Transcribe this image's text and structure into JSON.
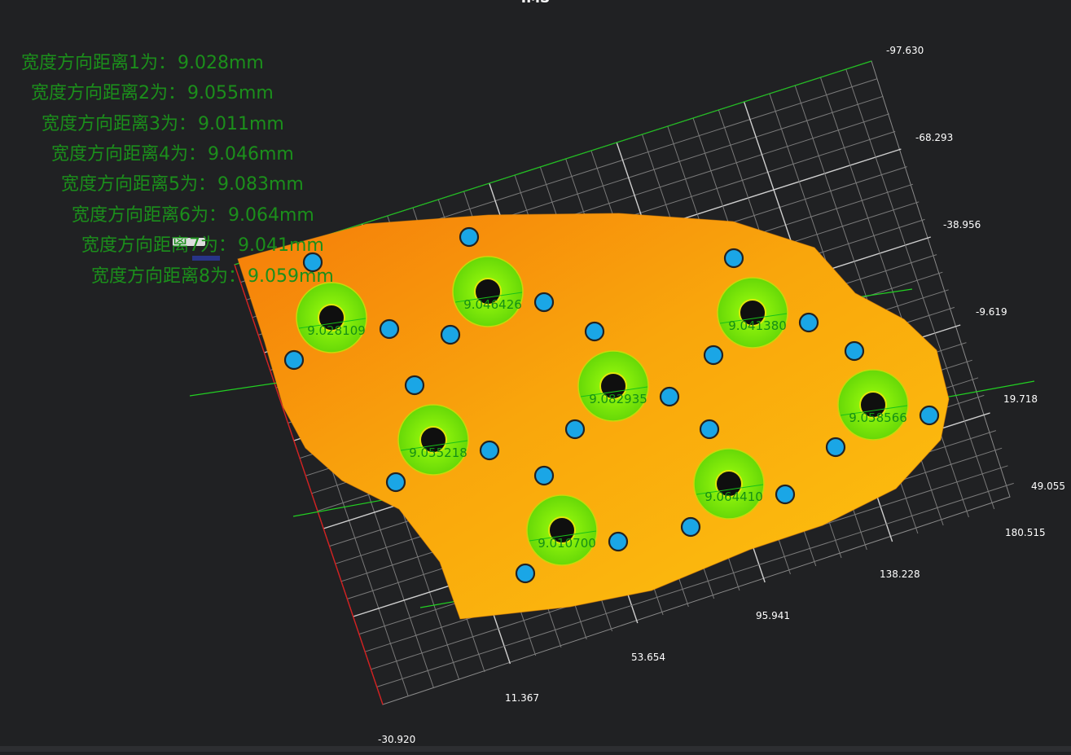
{
  "viewer": {
    "title": "IMS",
    "axis_ticks_right": [
      "-97.630",
      "-68.293",
      "-38.956",
      "-9.619",
      "19.718",
      "49.055"
    ],
    "axis_ticks_bottom": [
      "-30.920",
      "11.367",
      "53.654",
      "95.941",
      "138.228",
      "180.515"
    ]
  },
  "measurements": [
    {
      "label": "宽度方向距离1为：",
      "value": "9.028mm"
    },
    {
      "label": "宽度方向距离2为：",
      "value": "9.055mm"
    },
    {
      "label": "宽度方向距离3为：",
      "value": "9.011mm"
    },
    {
      "label": "宽度方向距离4为：",
      "value": "9.046mm"
    },
    {
      "label": "宽度方向距离5为：",
      "value": "9.083mm"
    },
    {
      "label": "宽度方向距离6为：",
      "value": "9.064mm"
    },
    {
      "label": "宽度方向距离7为：",
      "value": "9.041mm"
    },
    {
      "label": "宽度方向距离8为：",
      "value": "9.059mm"
    }
  ],
  "ring_labels": [
    "9.028109",
    "9.046426",
    "9.041380",
    "9.082935",
    "9.058566",
    "9.055218",
    "9.064410",
    "9.010700"
  ],
  "colors": {
    "background": "#202123",
    "grid": "#8a8a8a",
    "axis_x": "#e02020",
    "axis_y": "#20c020",
    "part_orange": "#f7a20a",
    "ring_green": "#7ae80a",
    "hole_blue": "#1aa6e6",
    "text_green": "#1b8f1b"
  }
}
